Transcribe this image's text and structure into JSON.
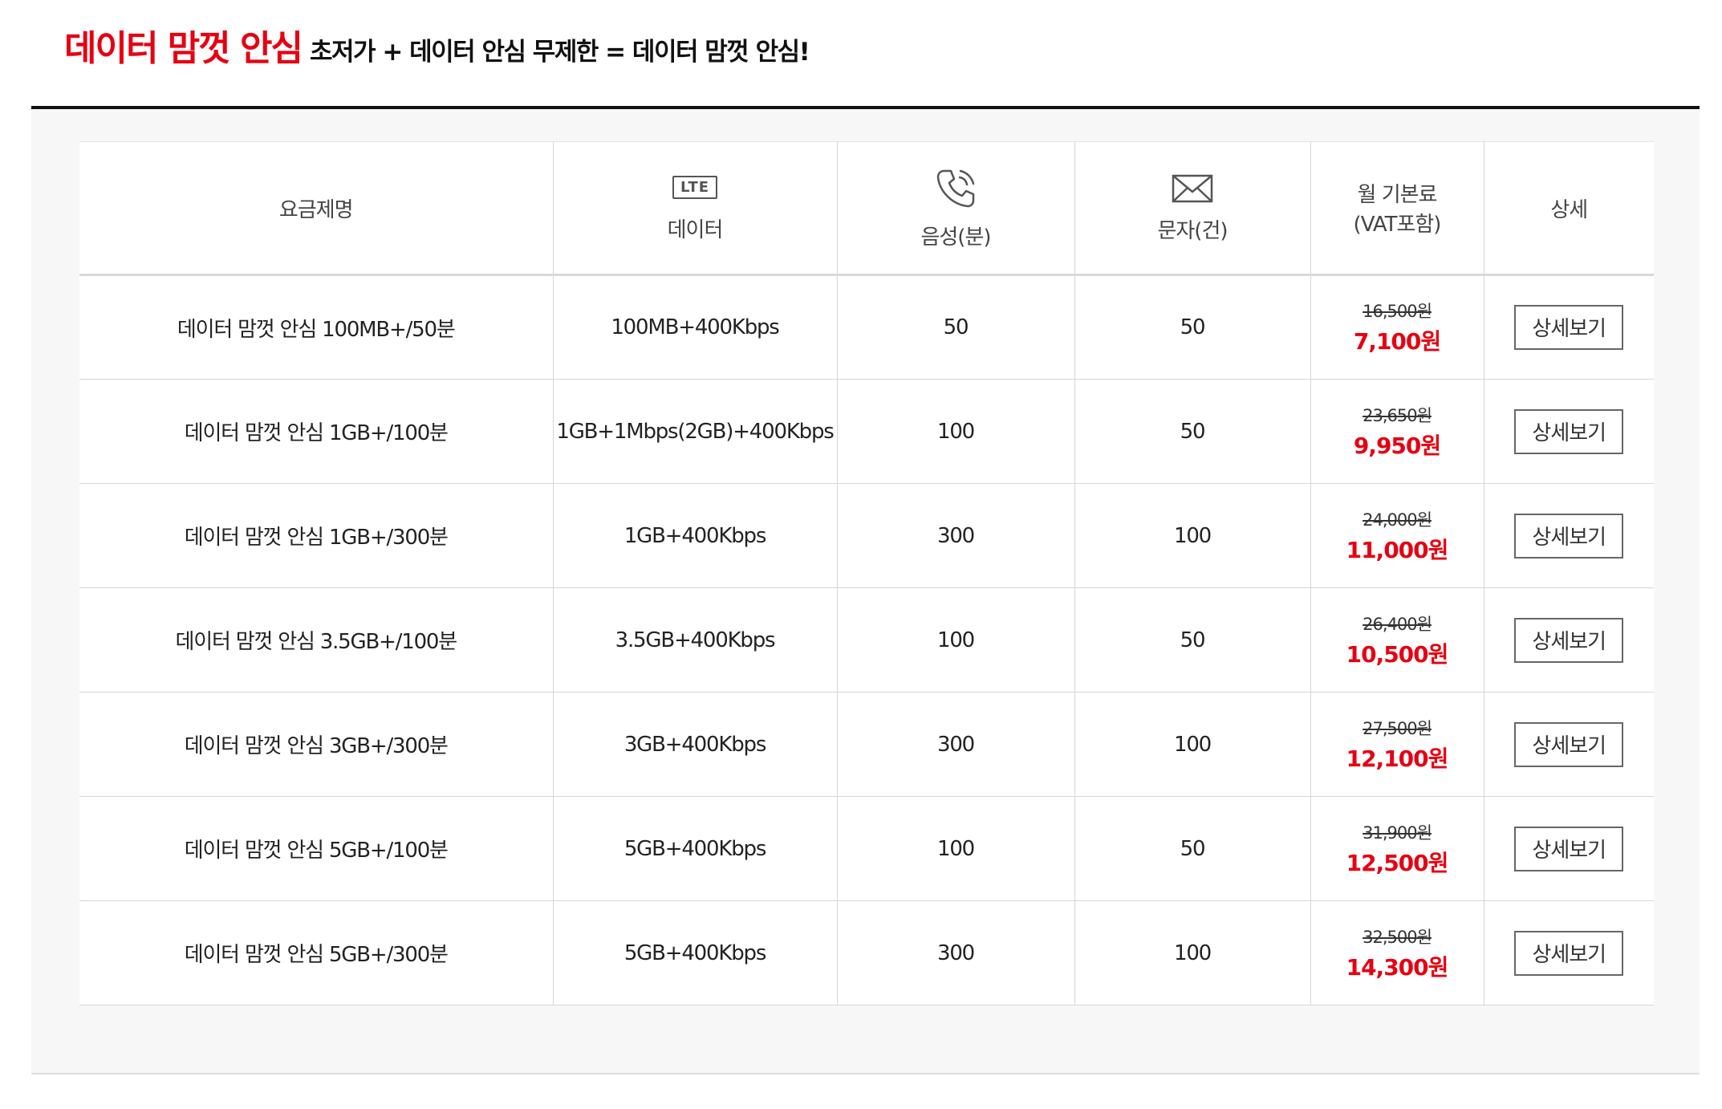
{
  "header": {
    "title": "데이터 맘껏 안심",
    "subtitle": "초저가 + 데이터 안심 무제한 = 데이터 맘껏 안심!"
  },
  "table": {
    "columns": {
      "name": "요금제명",
      "data_icon_text": "LTE",
      "data": "데이터",
      "voice": "음성(분)",
      "sms": "문자(건)",
      "fee_line1": "월 기본료",
      "fee_line2": "(VAT포함)",
      "detail": "상세"
    },
    "icons": {
      "data": "lte-icon",
      "voice": "phone-icon",
      "sms": "envelope-icon"
    },
    "button_label": "상세보기",
    "rows": [
      {
        "name": "데이터 맘껏 안심 100MB+/50분",
        "data": "100MB+400Kbps",
        "voice": "50",
        "sms": "50",
        "original_price": "16,500원",
        "price": "7,100원"
      },
      {
        "name": "데이터 맘껏 안심 1GB+/100분",
        "data": "1GB+1Mbps(2GB)+400Kbps",
        "voice": "100",
        "sms": "50",
        "original_price": "23,650원",
        "price": "9,950원"
      },
      {
        "name": "데이터 맘껏 안심 1GB+/300분",
        "data": "1GB+400Kbps",
        "voice": "300",
        "sms": "100",
        "original_price": "24,000원",
        "price": "11,000원"
      },
      {
        "name": "데이터 맘껏 안심 3.5GB+/100분",
        "data": "3.5GB+400Kbps",
        "voice": "100",
        "sms": "50",
        "original_price": "26,400원",
        "price": "10,500원"
      },
      {
        "name": "데이터 맘껏 안심 3GB+/300분",
        "data": "3GB+400Kbps",
        "voice": "300",
        "sms": "100",
        "original_price": "27,500원",
        "price": "12,100원"
      },
      {
        "name": "데이터 맘껏 안심 5GB+/100분",
        "data": "5GB+400Kbps",
        "voice": "100",
        "sms": "50",
        "original_price": "31,900원",
        "price": "12,500원"
      },
      {
        "name": "데이터 맘껏 안심 5GB+/300분",
        "data": "5GB+400Kbps",
        "voice": "300",
        "sms": "100",
        "original_price": "32,500원",
        "price": "14,300원"
      }
    ]
  },
  "colors": {
    "accent": "#e60012",
    "border": "#d6d6d6",
    "panel_bg": "#f7f7f7",
    "rule": "#111111"
  }
}
